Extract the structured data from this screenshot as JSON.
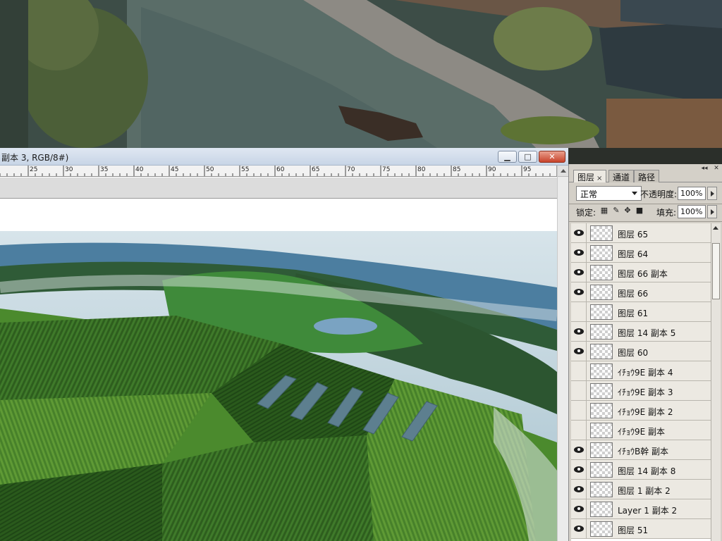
{
  "document": {
    "title": "副本 3, RGB/8#)",
    "window_buttons": {
      "minimize": "▁",
      "maximize": "□",
      "close": "✕"
    },
    "ruler_ticks": [
      "25",
      "30",
      "35",
      "40",
      "45",
      "50",
      "55",
      "60",
      "65",
      "70",
      "75",
      "80",
      "85",
      "90",
      "95"
    ]
  },
  "layers_panel": {
    "tabs": [
      {
        "label": "图层",
        "close": "×"
      },
      {
        "label": "通道"
      },
      {
        "label": "路径"
      }
    ],
    "blend_mode": "正常",
    "opacity_label": "不透明度:",
    "opacity_value": "100%",
    "lock_label": "锁定:",
    "fill_label": "填充:",
    "fill_value": "100%",
    "lock_icons": [
      "lock-transparent-icon",
      "lock-brush-icon",
      "lock-move-icon",
      "lock-all-icon"
    ],
    "layers": [
      {
        "name": "图层 65",
        "visible": true
      },
      {
        "name": "图层 64",
        "visible": true
      },
      {
        "name": "图层 66 副本",
        "visible": true
      },
      {
        "name": "图层 66",
        "visible": true
      },
      {
        "name": "图层 61",
        "visible": false
      },
      {
        "name": "图层 14 副本 5",
        "visible": true
      },
      {
        "name": "图层 60",
        "visible": true
      },
      {
        "name": "ｲﾁｮｳ9E 副本 4",
        "visible": false
      },
      {
        "name": "ｲﾁｮｳ9E 副本 3",
        "visible": false
      },
      {
        "name": "ｲﾁｮｳ9E 副本 2",
        "visible": false
      },
      {
        "name": "ｲﾁｮｳ9E 副本",
        "visible": false
      },
      {
        "name": "ｲﾁｮｳB幹 副本",
        "visible": true
      },
      {
        "name": "图层 14 副本 8",
        "visible": true
      },
      {
        "name": "图层 1 副本 2",
        "visible": true
      },
      {
        "name": "Layer 1 副本 2",
        "visible": true
      },
      {
        "name": "图层 51",
        "visible": true
      }
    ]
  },
  "colors": {
    "titlebar": "#c8d5e6",
    "panel_bg": "#d4d0c8",
    "close_button": "#c8432b"
  }
}
